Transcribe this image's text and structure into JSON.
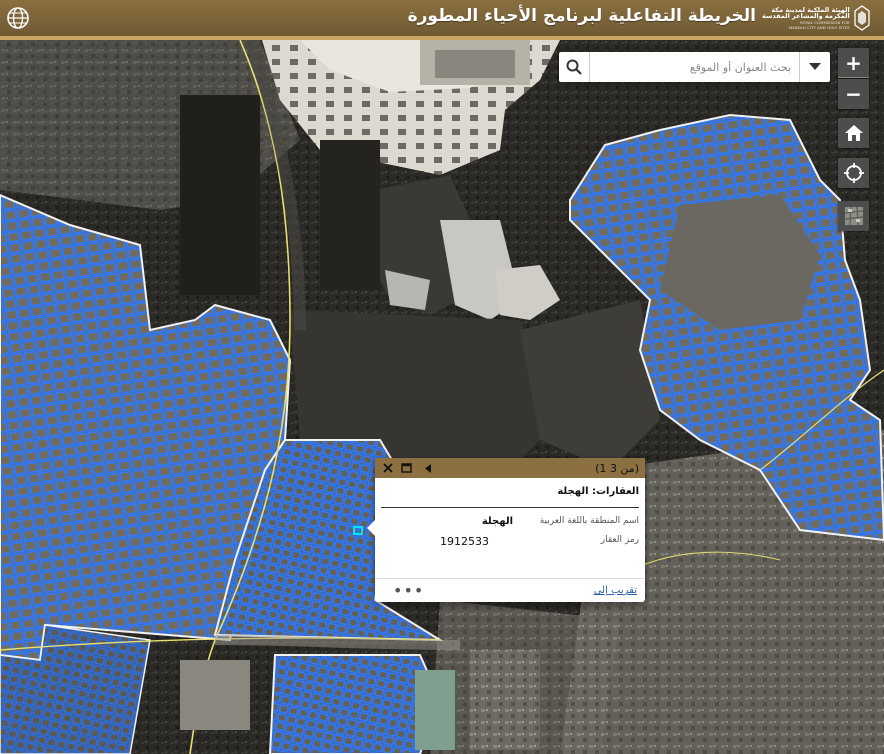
{
  "header": {
    "title": "الخريطة التفاعلية لبرنامج الأحياء المطورة",
    "logo": {
      "line1_ar": "الهيئة الملكية لمدينة مكة",
      "line2_ar": "المكرمة والمشاعر المقدسة",
      "line1_en": "ROYAL COMMISSION FOR",
      "line2_en": "MAKKAH CITY AND HOLY SITES"
    },
    "globe_icon": "globe-icon"
  },
  "search": {
    "placeholder": "بحث العنوان أو الموقع",
    "value": ""
  },
  "tools": {
    "zoom_in": "+",
    "zoom_out": "−",
    "home_icon": "home-icon",
    "locate_icon": "locate-icon",
    "basemap_icon": "basemap-icon"
  },
  "popup": {
    "count": "(1 من 3)",
    "title": "العقارات: الهجلة",
    "fields": [
      {
        "label": "اسم المنطقة باللغة العربية",
        "value": "الهجلة"
      },
      {
        "label": "رمز العقار",
        "value": "1912533"
      }
    ],
    "zoom_link": "تقريب إلى",
    "more": "•••"
  },
  "colors": {
    "header": "#7a6238",
    "accent": "#c8a560",
    "parcel_outline": "#2f7bff",
    "boundary": "#f2f2f2",
    "road_line": "#e8e070"
  }
}
